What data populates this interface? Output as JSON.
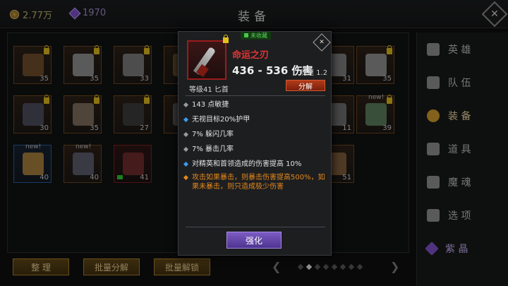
{
  "topbar": {
    "gold": "2.77万",
    "gems": "1970",
    "title": "装备",
    "close_icon": "close-icon"
  },
  "inventory": {
    "slots": [
      {
        "num": "35",
        "rarity": "brown",
        "locked": true,
        "color": "#6b4a2a"
      },
      {
        "num": "35",
        "rarity": "brown",
        "locked": true,
        "color": "#8a8a8a"
      },
      {
        "num": "33",
        "rarity": "brown",
        "locked": true,
        "color": "#777"
      },
      {
        "num": "",
        "rarity": "brown",
        "locked": true,
        "color": "#6a5030"
      },
      {
        "num": "31",
        "rarity": "brown",
        "locked": false,
        "color": "#7a7a7a"
      },
      {
        "num": "35",
        "rarity": "brown",
        "locked": true,
        "color": "#8a8a8a"
      },
      {
        "num": "30",
        "rarity": "brown",
        "locked": true,
        "color": "#4a4a5a"
      },
      {
        "num": "35",
        "rarity": "brown",
        "locked": true,
        "color": "#7a6a5a"
      },
      {
        "num": "27",
        "rarity": "brown",
        "locked": true,
        "color": "#3a3a3a"
      },
      {
        "num": "",
        "rarity": "brown",
        "locked": true,
        "color": "#5a5a5a"
      },
      {
        "num": "11",
        "rarity": "brown",
        "locked": false,
        "color": "#6a6a6a"
      },
      {
        "num": "39",
        "rarity": "brown",
        "locked": true,
        "new": true,
        "color": "#5a7a5a"
      },
      {
        "num": "40",
        "rarity": "blue",
        "locked": false,
        "new": true,
        "color": "#a07a3a"
      },
      {
        "num": "40",
        "rarity": "brown",
        "locked": false,
        "new": true,
        "color": "#5a5a6a"
      },
      {
        "num": "41",
        "rarity": "red",
        "locked": false,
        "green": true,
        "color": "#6a2a2a"
      },
      {
        "num": "51",
        "rarity": "brown",
        "locked": false,
        "color": "#7a5a3a"
      }
    ],
    "buttons": {
      "sort": "整 理",
      "batch_dismantle": "批量分解",
      "batch_unlock": "批量解锁"
    }
  },
  "sidebar": {
    "items": [
      {
        "label": "英 雄",
        "icon": "heroes-icon"
      },
      {
        "label": "队 伍",
        "icon": "flag-icon"
      },
      {
        "label": "装 备",
        "icon": "helmet-icon",
        "active": true
      },
      {
        "label": "道 具",
        "icon": "bag-icon"
      },
      {
        "label": "魔 魂",
        "icon": "flame-icon"
      },
      {
        "label": "选 项",
        "icon": "gear-icon"
      },
      {
        "label": "紫 晶",
        "icon": "amethyst-icon"
      }
    ]
  },
  "detail": {
    "fav_badge": "未收藏",
    "name": "命运之刃",
    "damage": "436 - 536 伤害",
    "speed": "攻速 1.2",
    "level": "等级41 匕首",
    "dismantle": "分解",
    "stats": [
      {
        "text": "143 点敏捷",
        "kind": "grey"
      },
      {
        "text": "无视目标20%护甲",
        "kind": "blue"
      },
      {
        "text": "7% 躲闪几率",
        "kind": "grey"
      },
      {
        "text": "7% 暴击几率",
        "kind": "grey"
      },
      {
        "text": "对精英和首领造成的伤害提高 10%",
        "kind": "blue"
      },
      {
        "text": "攻击如果暴击，则暴击伤害提高500%，如果未暴击，则只造成极少伤害",
        "kind": "orange"
      }
    ],
    "enhance": "强化",
    "colors": {
      "name": "#e23434",
      "special": "#e4881c",
      "enhance": "#6a4ab0"
    }
  }
}
